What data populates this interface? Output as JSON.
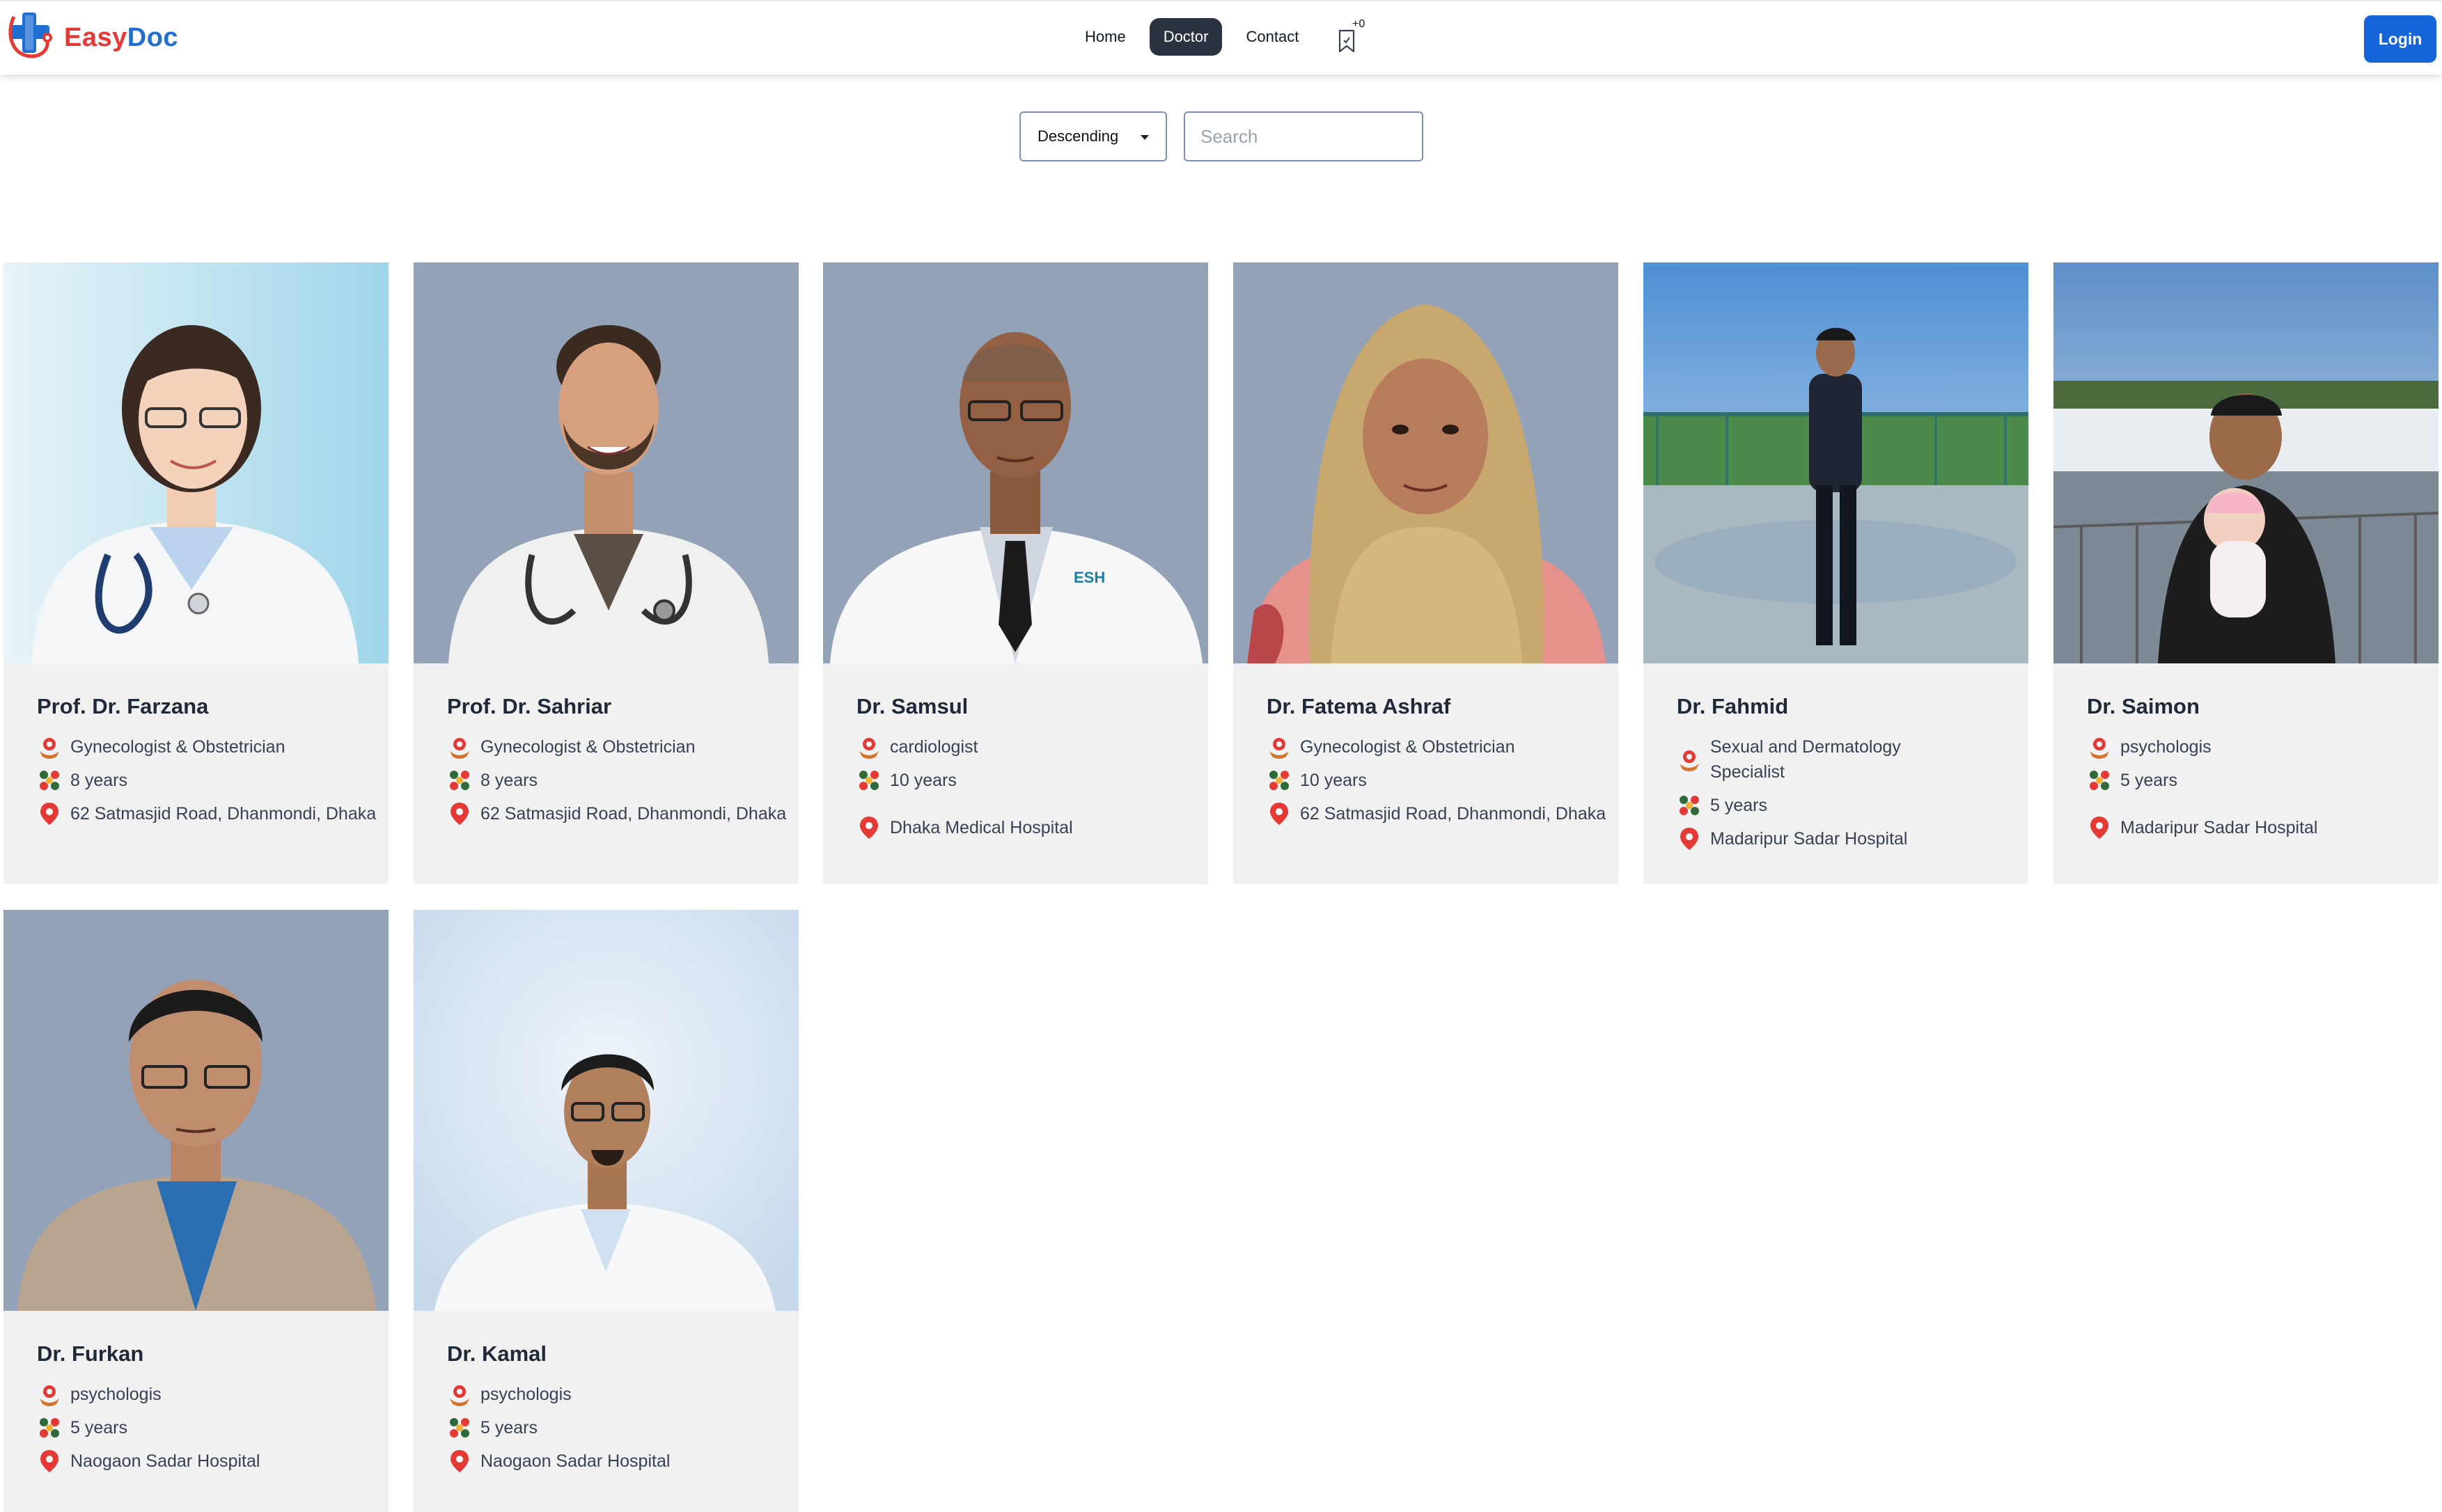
{
  "brand": {
    "part1": "Easy",
    "part2": "Doc"
  },
  "nav": {
    "home": "Home",
    "doctor": "Doctor",
    "contact": "Contact",
    "bookmark_count": "+0"
  },
  "login_label": "Login",
  "filters": {
    "sort_value": "Descending",
    "search_placeholder": "Search",
    "search_value": ""
  },
  "colors": {
    "brand_red": "#e53935",
    "brand_blue": "#1e6fd1",
    "login_bg": "#1565d8",
    "active_nav": "#2c3340",
    "card_bg": "#f1f1f1",
    "pin": "#e53935"
  },
  "doctors": [
    {
      "name": "Prof. Dr. Farzana",
      "specialty": "Gynecologist & Obstetrician",
      "experience": "8 years",
      "location": "62 Satmasjid Road, Dhanmondi, Dhaka"
    },
    {
      "name": "Prof. Dr. Sahriar",
      "specialty": "Gynecologist & Obstetrician",
      "experience": "8 years",
      "location": "62 Satmasjid Road, Dhanmondi, Dhaka"
    },
    {
      "name": "Dr. Samsul",
      "specialty": "cardiologist",
      "experience": "10 years",
      "location": "Dhaka Medical Hospital"
    },
    {
      "name": "Dr. Fatema Ashraf",
      "specialty": "Gynecologist & Obstetrician",
      "experience": "10 years",
      "location": "62 Satmasjid Road, Dhanmondi, Dhaka"
    },
    {
      "name": "Dr. Fahmid",
      "specialty": "Sexual and Dermatology Specialist",
      "experience": "5 years",
      "location": "Madaripur Sadar Hospital"
    },
    {
      "name": "Dr. Saimon",
      "specialty": "psychologis",
      "experience": "5 years",
      "location": "Madaripur Sadar Hospital"
    },
    {
      "name": "Dr. Furkan",
      "specialty": "psychologis",
      "experience": "5 years",
      "location": "Naogaon Sadar Hospital"
    },
    {
      "name": "Dr. Kamal",
      "specialty": "psychologis",
      "experience": "5 years",
      "location": "Naogaon Sadar Hospital"
    }
  ]
}
